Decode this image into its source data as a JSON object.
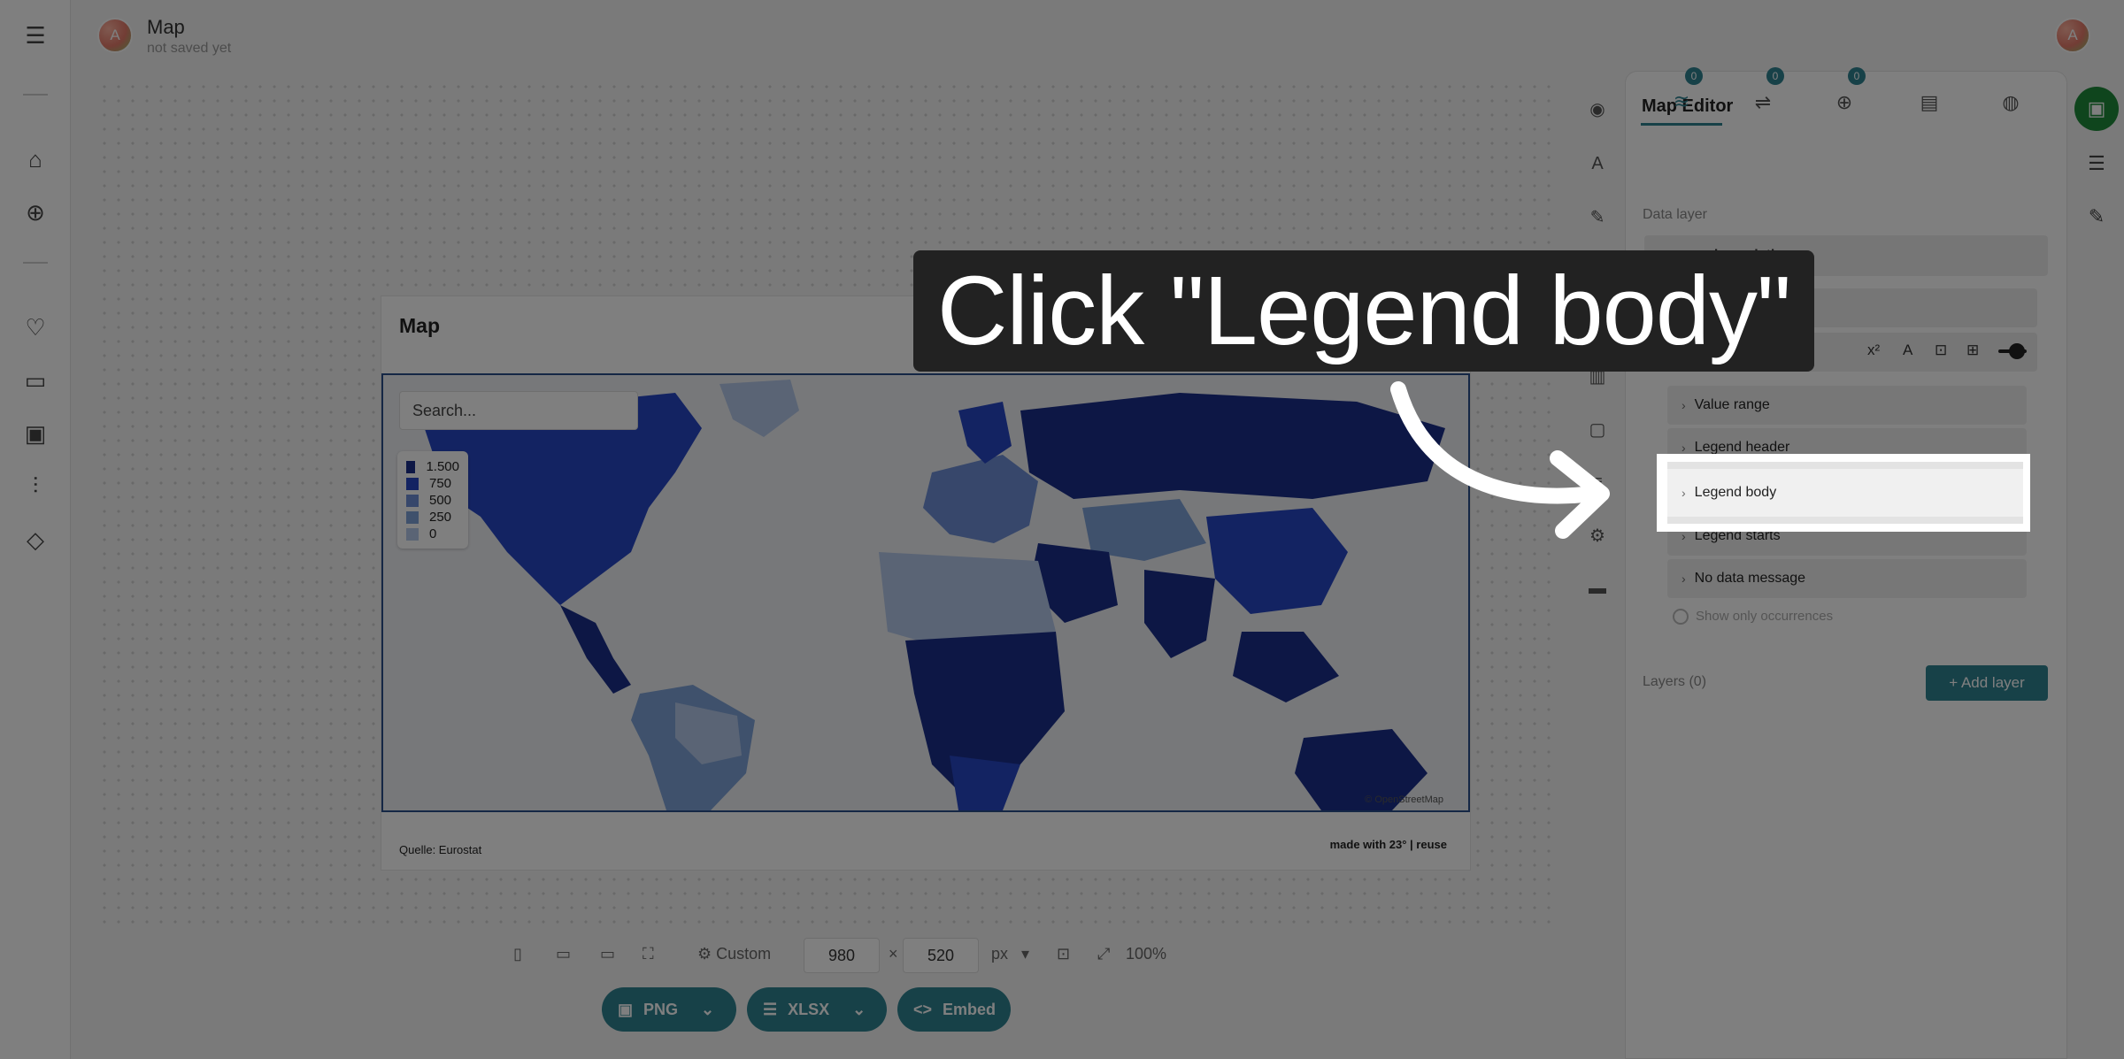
{
  "app": {
    "title": "Map",
    "subtitle": "not saved yet",
    "user_initial": "A"
  },
  "nav": {
    "icons": [
      "menu-icon",
      "home-icon",
      "add-icon",
      "heart-icon",
      "folder-icon",
      "image-icon",
      "sliders-icon",
      "graduation-icon"
    ]
  },
  "card": {
    "title": "Map",
    "search_placeholder": "Search...",
    "legend": [
      {
        "label": "1.500",
        "color": "#1a2f8a"
      },
      {
        "label": "750",
        "color": "#2747c4"
      },
      {
        "label": "500",
        "color": "#6e8fd6"
      },
      {
        "label": "250",
        "color": "#7ea3d8"
      },
      {
        "label": "0",
        "color": "#b4c8ea"
      }
    ],
    "attribution": "© OpenStreetMap",
    "source": "Quelle: Eurostat",
    "made_with": "made with 23° | reuse"
  },
  "bottombar": {
    "size_preset": "Custom",
    "width": "980",
    "height": "520",
    "unit": "px",
    "zoom": "100%",
    "export_png": "PNG",
    "export_xlsx": "XLSX",
    "embed": "Embed"
  },
  "panel": {
    "title": "Map Editor",
    "tab_badges": [
      "0",
      "0",
      "0"
    ],
    "data_layer_label": "Data layer",
    "layer_name": "choropleth",
    "accordion": [
      "Value range",
      "Legend header",
      "Legend body",
      "Legend starts",
      "No data message"
    ],
    "show_only": "Show only occurrences",
    "layers_count": "Layers (0)",
    "add_layer": "+ Add layer"
  },
  "colors": {
    "accent": "#2e8291",
    "save": "#1f8a3a",
    "map_dark": "#1a2f8a"
  },
  "instruction": {
    "text": "Click \"Legend body\"",
    "target": "Legend body"
  }
}
